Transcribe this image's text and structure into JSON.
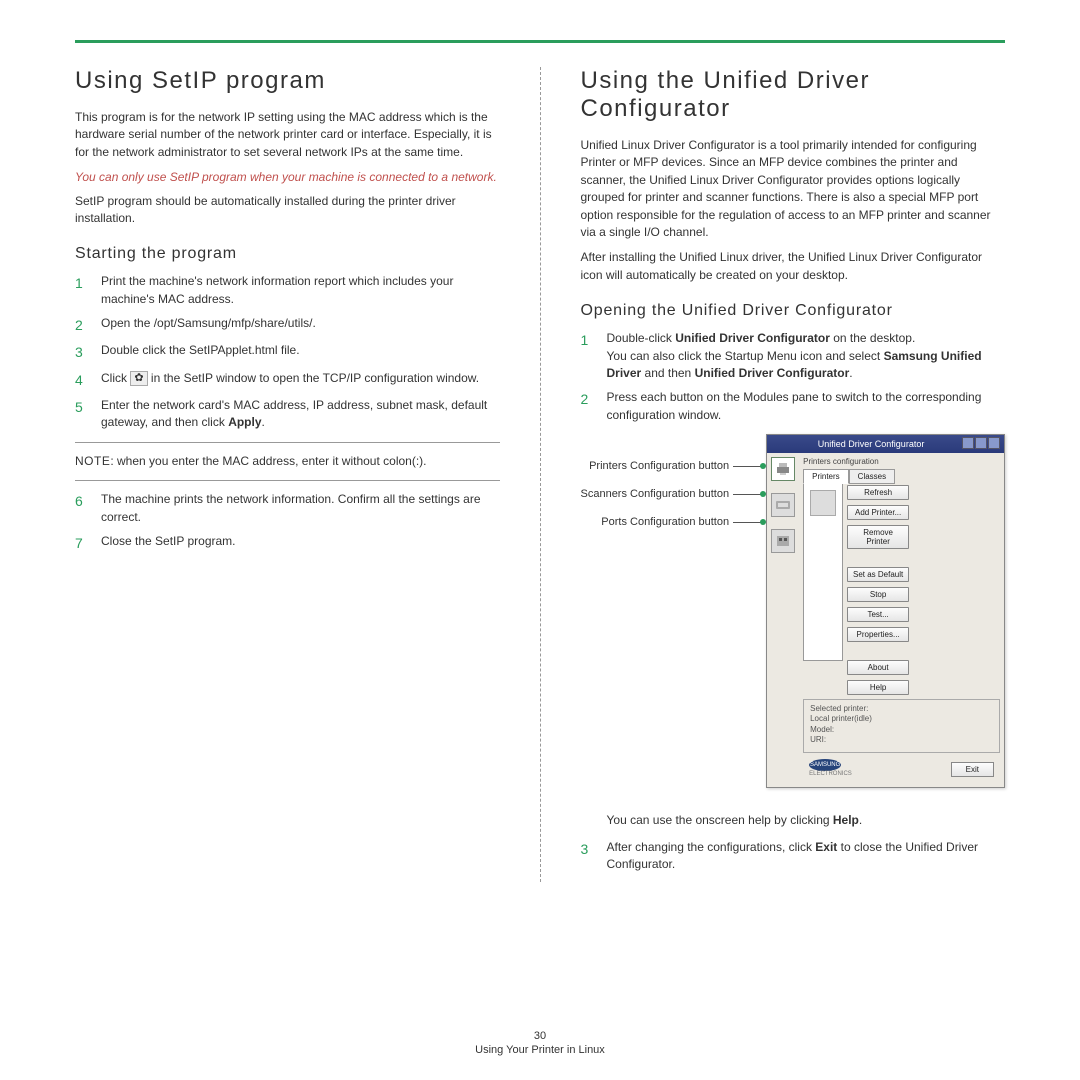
{
  "left": {
    "h1": "Using SetIP program",
    "p1": "This program is for the network IP setting using the MAC address which is the hardware serial number of the network printer card or interface. Especially, it is for the network administrator to set several network IPs at the same time.",
    "warn": "You can only use SetIP program when your machine is connected to a network.",
    "p2": "SetIP program should be automatically installed during the printer driver installation.",
    "h2": "Starting the program",
    "steps": [
      "Print the machine's network information report which includes your machine's MAC address.",
      "Open the /opt/Samsung/mfp/share/utils/.",
      "Double click the SetIPApplet.html file.",
      "Click  in the SetIP window to open the TCP/IP configuration window.",
      "Enter the network card's MAC address, IP address, subnet mask, default gateway, and then click Apply."
    ],
    "note_label": "NOTE",
    "note": ": when you enter the MAC address, enter it without colon(:).",
    "steps2": [
      "The machine prints the network information. Confirm all the settings are correct.",
      "Close the SetIP program."
    ],
    "step4_pre": "Click ",
    "step4_post": " in the SetIP window to open the TCP/IP configuration window.",
    "step5_pre": "Enter the network card's MAC address, IP address, subnet mask, default gateway, and then click ",
    "step5_bold": "Apply",
    "step5_post": "."
  },
  "right": {
    "h1": "Using the Unified Driver Configurator",
    "p1": "Unified Linux Driver Configurator is a tool primarily intended for configuring Printer or MFP devices. Since an MFP device combines the printer and scanner, the Unified Linux Driver Configurator provides options logically grouped for printer and scanner functions. There is also a special MFP port option responsible for the regulation of access to an MFP printer and scanner via a single I/O channel.",
    "p2": "After installing the Unified Linux driver, the Unified Linux Driver Configurator icon will automatically be created on your desktop.",
    "h2": "Opening the Unified Driver Configurator",
    "step1_a": "Double-click ",
    "step1_bold": "Unified Driver Configurator",
    "step1_b": " on the desktop.",
    "step1_c": "You can also click the Startup Menu icon and select ",
    "step1_bold2": "Samsung Unified Driver",
    "step1_d": " and then ",
    "step1_bold3": "Unified Driver Configurator",
    "step1_e": ".",
    "step2": "Press each button on the Modules pane to switch to the corresponding configuration window.",
    "callouts": {
      "printers": "Printers Configuration button",
      "scanners": "Scanners Configuration button",
      "ports": "Ports Configuration button"
    },
    "app": {
      "title": "Unified Driver Configurator",
      "group": "Printers configuration",
      "tabs": [
        "Printers",
        "Classes"
      ],
      "buttons": [
        "Refresh",
        "Add Printer...",
        "Remove Printer",
        "Set as Default",
        "Stop",
        "Test...",
        "Properties...",
        "About",
        "Help"
      ],
      "sel_label": "Selected printer:",
      "sel_line1": "Local printer(idle)",
      "sel_line2": "Model:",
      "sel_line3": "URI:",
      "logo1": "SAMSUNG",
      "logo2": "ELECTRONICS",
      "exit": "Exit"
    },
    "after1_pre": "You can use the onscreen help by clicking ",
    "after1_bold": "Help",
    "after1_post": ".",
    "step3_pre": "After changing the configurations, click ",
    "step3_bold": "Exit",
    "step3_post": " to close the Unified Driver Configurator."
  },
  "footer": {
    "page": "30",
    "section": "Using Your Printer in Linux"
  }
}
